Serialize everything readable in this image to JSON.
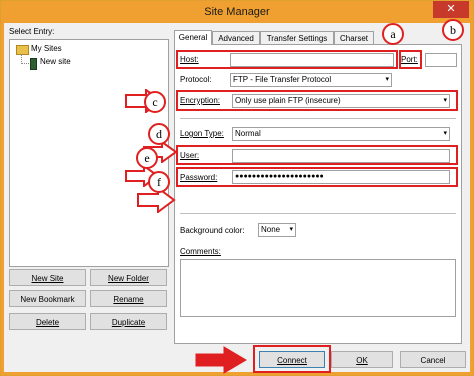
{
  "window": {
    "title": "Site Manager",
    "close_glyph": "✕"
  },
  "sidebar": {
    "label": "Select Entry:",
    "tree": [
      {
        "label": "My Sites",
        "icon": "folder-icon"
      },
      {
        "label": "New site",
        "icon": "server-icon"
      }
    ],
    "buttons": {
      "new_site": "New Site",
      "new_folder": "New Folder",
      "new_bookmark": "New Bookmark",
      "rename": "Rename",
      "delete": "Delete",
      "duplicate": "Duplicate"
    }
  },
  "tabs": [
    "General",
    "Advanced",
    "Transfer Settings",
    "Charset"
  ],
  "general": {
    "host_label": "Host:",
    "host_value": "",
    "port_label": "Port:",
    "port_value": "",
    "protocol_label": "Protocol:",
    "protocol_value": "FTP - File Transfer Protocol",
    "encryption_label": "Encryption:",
    "encryption_value": "Only use plain FTP (insecure)",
    "logon_label": "Logon Type:",
    "logon_value": "Normal",
    "user_label": "User:",
    "user_value": "",
    "password_label": "Password:",
    "password_value": "●●●●●●●●●●●●●●●●●●●●●",
    "bgcolor_label": "Background color:",
    "bgcolor_value": "None",
    "comments_label": "Comments:"
  },
  "footer": {
    "connect": "Connect",
    "ok": "OK",
    "cancel": "Cancel"
  },
  "annotations": {
    "a": "a",
    "b": "b",
    "c": "c",
    "d": "d",
    "e": "e",
    "f": "f"
  },
  "colors": {
    "highlight": "#e02020",
    "titlebar": "#f0a030"
  }
}
